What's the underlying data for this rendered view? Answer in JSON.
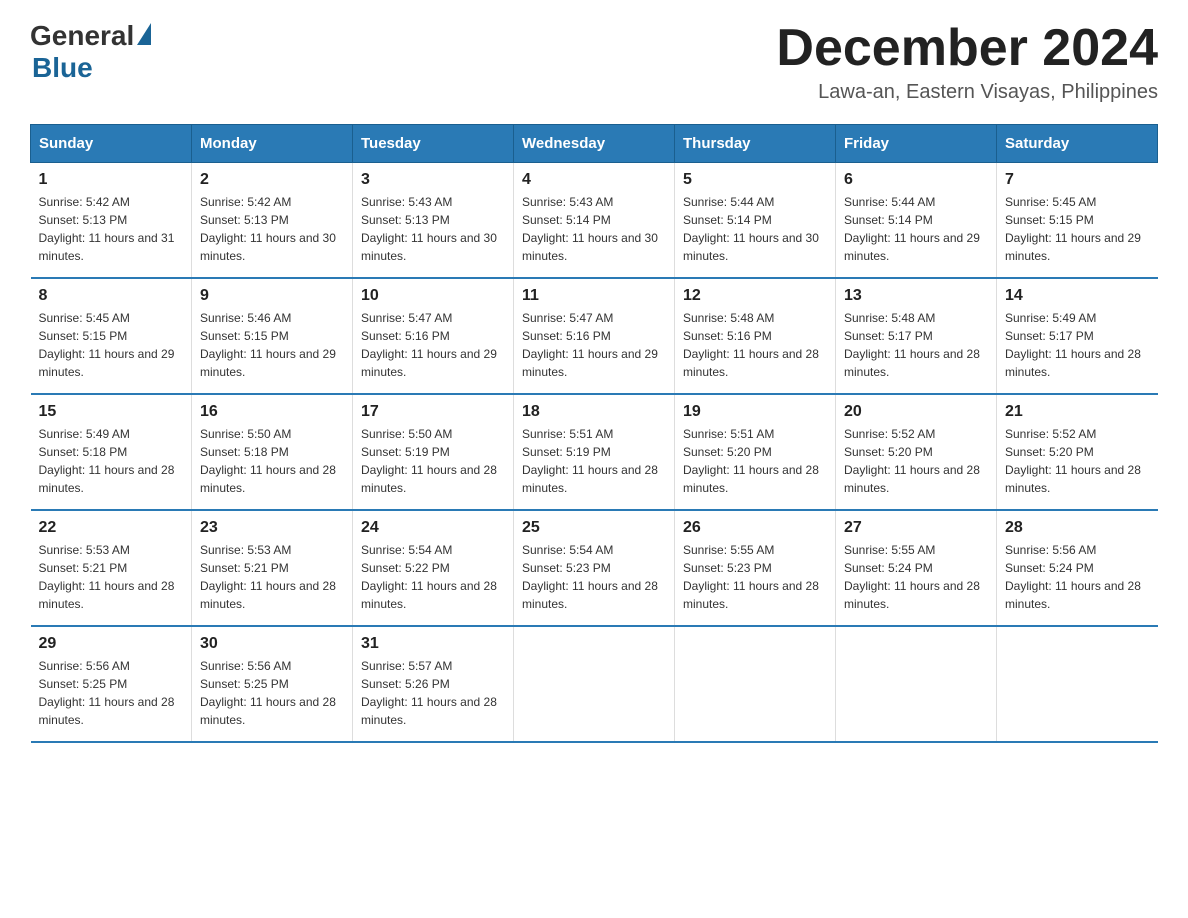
{
  "logo": {
    "general": "General",
    "blue": "Blue"
  },
  "title": {
    "month_year": "December 2024",
    "location": "Lawa-an, Eastern Visayas, Philippines"
  },
  "header_days": [
    "Sunday",
    "Monday",
    "Tuesday",
    "Wednesday",
    "Thursday",
    "Friday",
    "Saturday"
  ],
  "weeks": [
    [
      {
        "day": "1",
        "sunrise": "5:42 AM",
        "sunset": "5:13 PM",
        "daylight": "11 hours and 31 minutes."
      },
      {
        "day": "2",
        "sunrise": "5:42 AM",
        "sunset": "5:13 PM",
        "daylight": "11 hours and 30 minutes."
      },
      {
        "day": "3",
        "sunrise": "5:43 AM",
        "sunset": "5:13 PM",
        "daylight": "11 hours and 30 minutes."
      },
      {
        "day": "4",
        "sunrise": "5:43 AM",
        "sunset": "5:14 PM",
        "daylight": "11 hours and 30 minutes."
      },
      {
        "day": "5",
        "sunrise": "5:44 AM",
        "sunset": "5:14 PM",
        "daylight": "11 hours and 30 minutes."
      },
      {
        "day": "6",
        "sunrise": "5:44 AM",
        "sunset": "5:14 PM",
        "daylight": "11 hours and 29 minutes."
      },
      {
        "day": "7",
        "sunrise": "5:45 AM",
        "sunset": "5:15 PM",
        "daylight": "11 hours and 29 minutes."
      }
    ],
    [
      {
        "day": "8",
        "sunrise": "5:45 AM",
        "sunset": "5:15 PM",
        "daylight": "11 hours and 29 minutes."
      },
      {
        "day": "9",
        "sunrise": "5:46 AM",
        "sunset": "5:15 PM",
        "daylight": "11 hours and 29 minutes."
      },
      {
        "day": "10",
        "sunrise": "5:47 AM",
        "sunset": "5:16 PM",
        "daylight": "11 hours and 29 minutes."
      },
      {
        "day": "11",
        "sunrise": "5:47 AM",
        "sunset": "5:16 PM",
        "daylight": "11 hours and 29 minutes."
      },
      {
        "day": "12",
        "sunrise": "5:48 AM",
        "sunset": "5:16 PM",
        "daylight": "11 hours and 28 minutes."
      },
      {
        "day": "13",
        "sunrise": "5:48 AM",
        "sunset": "5:17 PM",
        "daylight": "11 hours and 28 minutes."
      },
      {
        "day": "14",
        "sunrise": "5:49 AM",
        "sunset": "5:17 PM",
        "daylight": "11 hours and 28 minutes."
      }
    ],
    [
      {
        "day": "15",
        "sunrise": "5:49 AM",
        "sunset": "5:18 PM",
        "daylight": "11 hours and 28 minutes."
      },
      {
        "day": "16",
        "sunrise": "5:50 AM",
        "sunset": "5:18 PM",
        "daylight": "11 hours and 28 minutes."
      },
      {
        "day": "17",
        "sunrise": "5:50 AM",
        "sunset": "5:19 PM",
        "daylight": "11 hours and 28 minutes."
      },
      {
        "day": "18",
        "sunrise": "5:51 AM",
        "sunset": "5:19 PM",
        "daylight": "11 hours and 28 minutes."
      },
      {
        "day": "19",
        "sunrise": "5:51 AM",
        "sunset": "5:20 PM",
        "daylight": "11 hours and 28 minutes."
      },
      {
        "day": "20",
        "sunrise": "5:52 AM",
        "sunset": "5:20 PM",
        "daylight": "11 hours and 28 minutes."
      },
      {
        "day": "21",
        "sunrise": "5:52 AM",
        "sunset": "5:20 PM",
        "daylight": "11 hours and 28 minutes."
      }
    ],
    [
      {
        "day": "22",
        "sunrise": "5:53 AM",
        "sunset": "5:21 PM",
        "daylight": "11 hours and 28 minutes."
      },
      {
        "day": "23",
        "sunrise": "5:53 AM",
        "sunset": "5:21 PM",
        "daylight": "11 hours and 28 minutes."
      },
      {
        "day": "24",
        "sunrise": "5:54 AM",
        "sunset": "5:22 PM",
        "daylight": "11 hours and 28 minutes."
      },
      {
        "day": "25",
        "sunrise": "5:54 AM",
        "sunset": "5:23 PM",
        "daylight": "11 hours and 28 minutes."
      },
      {
        "day": "26",
        "sunrise": "5:55 AM",
        "sunset": "5:23 PM",
        "daylight": "11 hours and 28 minutes."
      },
      {
        "day": "27",
        "sunrise": "5:55 AM",
        "sunset": "5:24 PM",
        "daylight": "11 hours and 28 minutes."
      },
      {
        "day": "28",
        "sunrise": "5:56 AM",
        "sunset": "5:24 PM",
        "daylight": "11 hours and 28 minutes."
      }
    ],
    [
      {
        "day": "29",
        "sunrise": "5:56 AM",
        "sunset": "5:25 PM",
        "daylight": "11 hours and 28 minutes."
      },
      {
        "day": "30",
        "sunrise": "5:56 AM",
        "sunset": "5:25 PM",
        "daylight": "11 hours and 28 minutes."
      },
      {
        "day": "31",
        "sunrise": "5:57 AM",
        "sunset": "5:26 PM",
        "daylight": "11 hours and 28 minutes."
      },
      null,
      null,
      null,
      null
    ]
  ]
}
